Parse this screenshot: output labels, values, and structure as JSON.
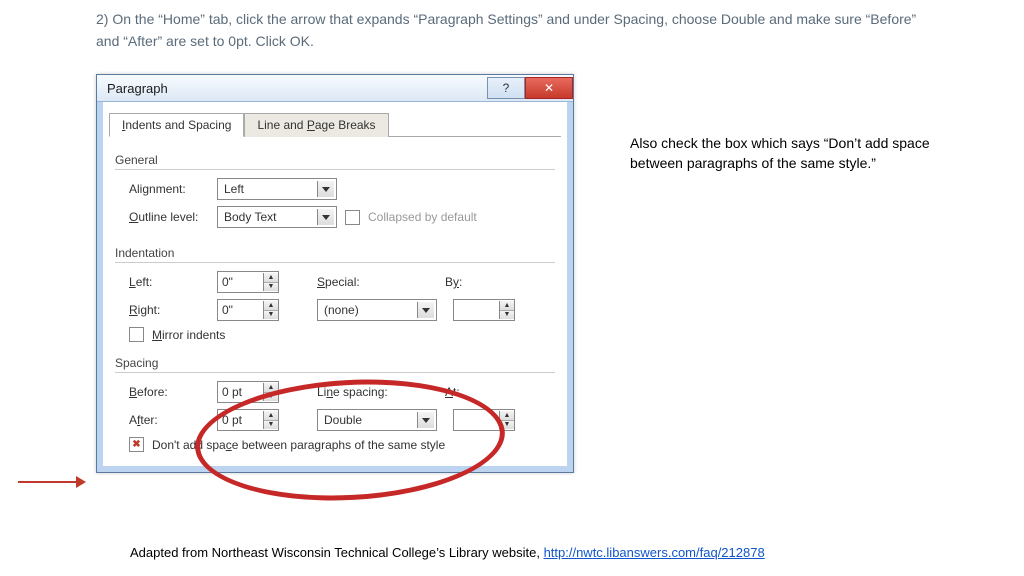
{
  "instruction": "2) On the “Home” tab, click the arrow that expands “Paragraph Settings” and under Spacing, choose Double and make sure “Before” and “After” are set to 0pt. Click OK.",
  "dialog": {
    "title": "Paragraph",
    "tabs": [
      "Indents and Spacing",
      "Line and Page Breaks"
    ],
    "active_tab": 0,
    "general": {
      "header": "General",
      "alignment_label": "Alignment:",
      "alignment_value": "Left",
      "outline_label": "Outline level:",
      "outline_value": "Body Text",
      "collapsed_label": "Collapsed by default"
    },
    "indentation": {
      "header": "Indentation",
      "left_label": "Left:",
      "left_value": "0\"",
      "right_label": "Right:",
      "right_value": "0\"",
      "special_label": "Special:",
      "special_value": "(none)",
      "by_label": "By:",
      "by_value": "",
      "mirror_label": "Mirror indents"
    },
    "spacing": {
      "header": "Spacing",
      "before_label": "Before:",
      "before_value": "0 pt",
      "after_label": "After:",
      "after_value": "0 pt",
      "linespacing_label": "Line spacing:",
      "linespacing_value": "Double",
      "at_label": "At:",
      "at_value": "",
      "noaddspace_label": "Don't add space between paragraphs of the same style"
    }
  },
  "side_note": "Also check the box which says “Don’t add space between paragraphs of the same style.”",
  "credit_prefix": "Adapted from Northeast Wisconsin Technical College’s Library website, ",
  "credit_url": "http://nwtc.libanswers.com/faq/212878"
}
